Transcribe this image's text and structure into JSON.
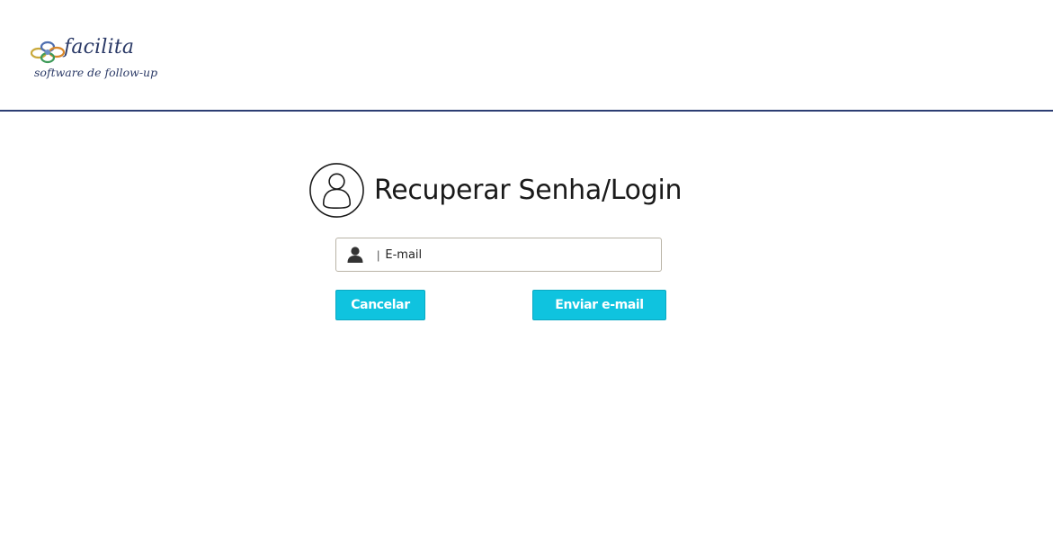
{
  "header": {
    "logo_name": "facilita",
    "logo_tagline": "software de follow-up"
  },
  "main": {
    "title": "Recuperar Senha/Login",
    "email": {
      "separator": "|",
      "placeholder": "E-mail",
      "value": ""
    },
    "buttons": {
      "cancel_label": "Cancelar",
      "send_label": "Enviar e-mail"
    }
  },
  "colors": {
    "header_rule": "#2d3e73",
    "button_bg": "#0fc3df",
    "logo_text": "#2b3a67"
  },
  "icons": {
    "title_icon": "user-circle-icon",
    "field_icon": "user-icon"
  }
}
